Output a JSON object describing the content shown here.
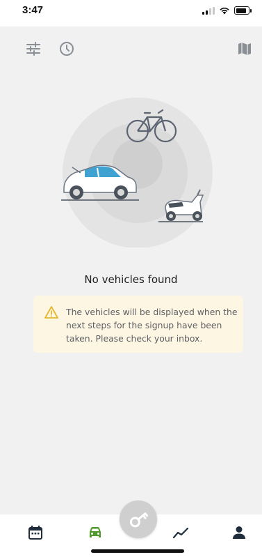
{
  "status_bar": {
    "time": "3:47"
  },
  "empty_state": {
    "title": "No vehicles found",
    "notice": "The vehicles will be displayed when the next steps for the signup have been taken. Please check your inbox."
  },
  "icons": {
    "filter": "sliders-icon",
    "history": "clock-icon",
    "map": "map-icon",
    "warning": "warning-triangle-icon",
    "calendar": "calendar-icon",
    "car": "car-icon",
    "key": "key-icon",
    "trips": "trend-line-icon",
    "profile": "person-icon"
  },
  "colors": {
    "background": "#f1f1f1",
    "notice_background": "#fdf6e3",
    "warning": "#e6b62e",
    "nav_active": "#4f9a2a",
    "nav_inactive": "#1f2d3d",
    "icon_gray": "#8a8f96"
  }
}
